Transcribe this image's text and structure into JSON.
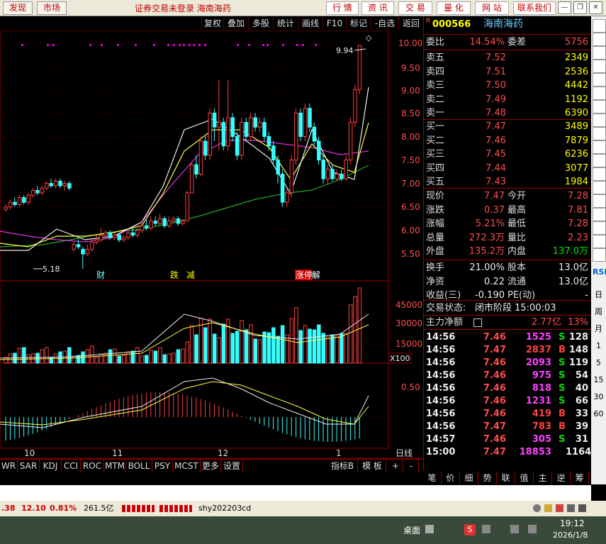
{
  "topbar": {
    "left_buttons": [
      "发现",
      "市场"
    ],
    "title": "证券交易未登录  海南海药",
    "nav_buttons": [
      "行 情",
      "资 讯",
      "交 易",
      "量 化",
      "网 站",
      "联系我们"
    ]
  },
  "toolbar": {
    "items": [
      "复权",
      "叠加",
      "多股",
      "统计",
      "画线",
      "F10",
      "标记",
      "-自选",
      "返回"
    ]
  },
  "chart": {
    "price_axis": [
      "10.00",
      "9.50",
      "9.00",
      "8.50",
      "8.00",
      "7.50",
      "7.00",
      "6.50",
      "6.00",
      "5.50"
    ],
    "high_label": "9.94",
    "low_label": "5.18",
    "events": [
      "财",
      "跌",
      "减",
      "涨停",
      "解"
    ],
    "vol_axis": [
      "45000",
      "30000",
      "15000"
    ],
    "vol_unit": "X100",
    "macd_axis": [
      "0.50"
    ],
    "months": [
      "10",
      "11",
      "12",
      "1"
    ],
    "period": "日线"
  },
  "stock": {
    "code": "000566",
    "name": "海南海药"
  },
  "quote": {
    "wb_label": "委比",
    "wb": "14.54%",
    "wc_label": "委差",
    "wc": "5756",
    "sell": [
      {
        "label": "卖五",
        "price": "7.52",
        "vol": "2349"
      },
      {
        "label": "卖四",
        "price": "7.51",
        "vol": "2536"
      },
      {
        "label": "卖三",
        "price": "7.50",
        "vol": "4442"
      },
      {
        "label": "卖二",
        "price": "7.49",
        "vol": "1192"
      },
      {
        "label": "卖一",
        "price": "7.48",
        "vol": "6390"
      }
    ],
    "buy": [
      {
        "label": "买一",
        "price": "7.47",
        "vol": "3489"
      },
      {
        "label": "买二",
        "price": "7.46",
        "vol": "7879"
      },
      {
        "label": "买三",
        "price": "7.45",
        "vol": "6236"
      },
      {
        "label": "买四",
        "price": "7.44",
        "vol": "3077"
      },
      {
        "label": "买五",
        "price": "7.43",
        "vol": "1984"
      }
    ],
    "stats": [
      {
        "l1": "现价",
        "v1": "7.47",
        "l2": "今开",
        "v2": "7.28"
      },
      {
        "l1": "涨跌",
        "v1": "0.37",
        "l2": "最高",
        "v2": "7.81"
      },
      {
        "l1": "涨幅",
        "v1": "5.21%",
        "l2": "最低",
        "v2": "7.28"
      },
      {
        "l1": "总量",
        "v1": "272.3万",
        "l2": "量比",
        "v2": "2.23"
      },
      {
        "l1": "外盘",
        "v1": "135.2万",
        "l2": "内盘",
        "v2": "137.0万"
      }
    ],
    "stats2": [
      {
        "l1": "换手",
        "v1": "21.00%",
        "l2": "股本",
        "v2": "13.0亿"
      },
      {
        "l1": "净资",
        "v1": "0.22",
        "l2": "流通",
        "v2": "13.0亿"
      },
      {
        "l1": "收益(三)",
        "v1": "-0.190",
        "l2": "PE(动)",
        "v2": "-"
      }
    ],
    "trade_status_label": "交易状态:",
    "trade_status": "闭市阶段 15:00:03",
    "main_net_label": "主力净额",
    "main_net": "2.77亿",
    "main_net_pct": "13%"
  },
  "ticks": [
    {
      "t": "14:56",
      "p": "7.46",
      "v": "1525",
      "s": "S",
      "n": "128"
    },
    {
      "t": "14:56",
      "p": "7.47",
      "v": "2837",
      "s": "B",
      "n": "148"
    },
    {
      "t": "14:56",
      "p": "7.46",
      "v": "2093",
      "s": "S",
      "n": "119"
    },
    {
      "t": "14:56",
      "p": "7.46",
      "v": "975",
      "s": "S",
      "n": "54"
    },
    {
      "t": "14:56",
      "p": "7.46",
      "v": "818",
      "s": "S",
      "n": "40"
    },
    {
      "t": "14:56",
      "p": "7.46",
      "v": "1231",
      "s": "S",
      "n": "66"
    },
    {
      "t": "14:56",
      "p": "7.46",
      "v": "419",
      "s": "B",
      "n": "33"
    },
    {
      "t": "14:56",
      "p": "7.47",
      "v": "783",
      "s": "B",
      "n": "39"
    },
    {
      "t": "14:57",
      "p": "7.46",
      "v": "305",
      "s": "S",
      "n": "31"
    },
    {
      "t": "15:00",
      "p": "7.47",
      "v": "18853",
      "s": "",
      "n": "1164"
    }
  ],
  "bottom_tabs": [
    "WR",
    "SAR",
    "KDJ",
    "CCI",
    "ROC",
    "MTM",
    "BOLL",
    "PSY",
    "MCST",
    "更多",
    "设置"
  ],
  "bottom_right_tabs": [
    "指标B",
    "模 板",
    "+",
    "-"
  ],
  "right_tabs": [
    "笔",
    "价",
    "细",
    "势",
    "联",
    "值",
    "主",
    "逆",
    "筹"
  ],
  "side_icons": [
    "RSI",
    "日",
    "周",
    "月",
    "1",
    "5",
    "15",
    "30",
    "60"
  ],
  "statusbar": {
    "v1": ".38",
    "v2": "12.10",
    "v3": "0.81%",
    "v4": "261.5亿",
    "user": "shy202203cd"
  },
  "taskbar": {
    "desktop": "桌面",
    "time": "19:12",
    "date": "2026/1/8"
  }
}
